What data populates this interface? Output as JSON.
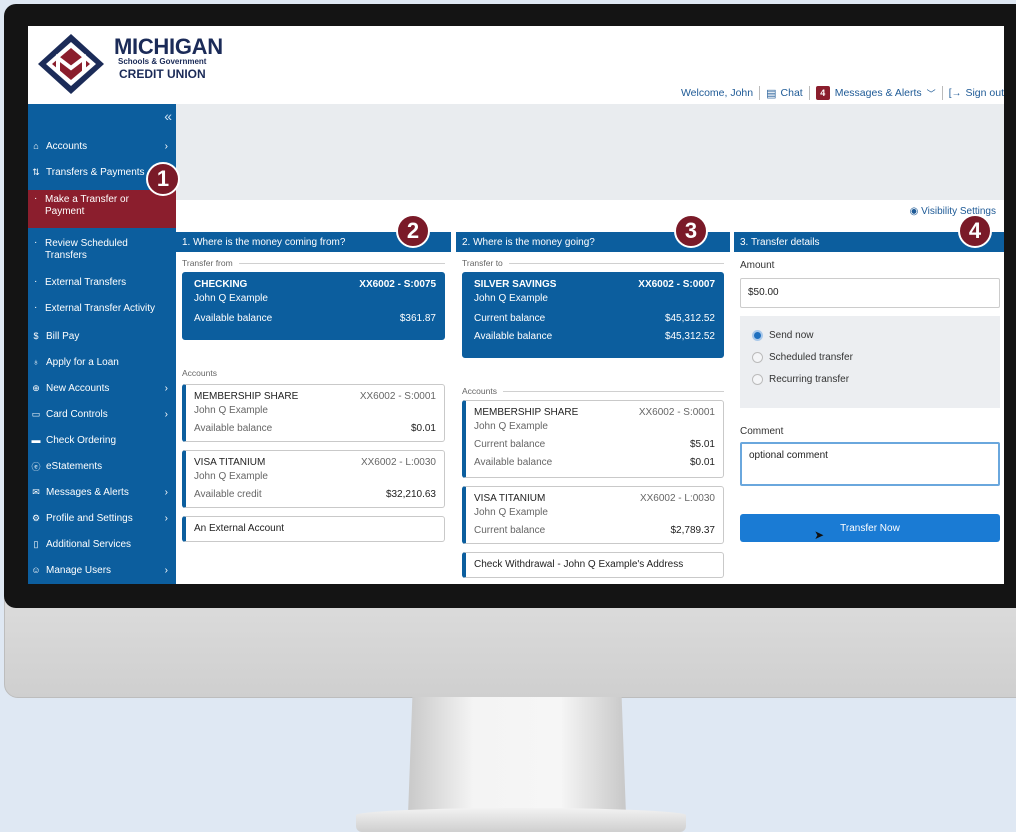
{
  "brand": {
    "line1": "MICHIGAN",
    "line2": "Schools & Government",
    "line3": "CREDIT UNION"
  },
  "topnav": {
    "welcome": "Welcome, John",
    "chat": "Chat",
    "messages_count": "4",
    "messages": "Messages & Alerts",
    "signout": "Sign out"
  },
  "sidebar": {
    "collapse": "«",
    "accounts": "Accounts",
    "transfers": "Transfers & Payments",
    "make_transfer": "Make a Transfer or Payment",
    "review_scheduled": "Review Scheduled Transfers",
    "external_transfers": "External Transfers",
    "external_activity": "External Transfer Activity",
    "bill_pay": "Bill Pay",
    "apply_loan": "Apply for a Loan",
    "new_accounts": "New Accounts",
    "card_controls": "Card Controls",
    "check_ordering": "Check Ordering",
    "estatements": "eStatements",
    "messages_alerts": "Messages & Alerts",
    "profile_settings": "Profile and Settings",
    "additional_services": "Additional Services",
    "manage_users": "Manage Users"
  },
  "visibility_settings": "Visibility Settings",
  "from": {
    "header": "1. Where is the money coming from?",
    "legend": "Transfer from",
    "selected": {
      "name": "CHECKING",
      "number": "XX6002 - S:0075",
      "owner": "John Q Example",
      "bal_label": "Available balance",
      "bal": "$361.87"
    },
    "accounts_legend": "Accounts",
    "membership": {
      "name": "MEMBERSHIP SHARE",
      "number": "XX6002 - S:0001",
      "owner": "John Q Example",
      "bal_label": "Available balance",
      "bal": "$0.01"
    },
    "visa": {
      "name": "VISA TITANIUM",
      "number": "XX6002 - L:0030",
      "owner": "John Q Example",
      "bal_label": "Available credit",
      "bal": "$32,210.63"
    },
    "external": "An External Account"
  },
  "to": {
    "header": "2. Where is the money going?",
    "legend": "Transfer to",
    "selected": {
      "name": "SILVER SAVINGS",
      "number": "XX6002 - S:0007",
      "owner": "John Q Example",
      "cur_label": "Current balance",
      "cur": "$45,312.52",
      "avail_label": "Available balance",
      "avail": "$45,312.52"
    },
    "accounts_legend": "Accounts",
    "membership": {
      "name": "MEMBERSHIP SHARE",
      "number": "XX6002 - S:0001",
      "owner": "John Q Example",
      "cur_label": "Current balance",
      "cur": "$5.01",
      "avail_label": "Available balance",
      "avail": "$0.01"
    },
    "visa": {
      "name": "VISA TITANIUM",
      "number": "XX6002 - L:0030",
      "owner": "John Q Example",
      "cur_label": "Current balance",
      "cur": "$2,789.37"
    },
    "check": "Check Withdrawal - John Q Example's Address"
  },
  "details": {
    "header": "3. Transfer details",
    "amount_label": "Amount",
    "amount": "$50.00",
    "send_now": "Send now",
    "scheduled": "Scheduled transfer",
    "recurring": "Recurring transfer",
    "comment_label": "Comment",
    "comment_placeholder": "optional comment",
    "submit": "Transfer Now"
  },
  "callouts": {
    "n1": "1",
    "n2": "2",
    "n3": "3",
    "n4": "4"
  }
}
